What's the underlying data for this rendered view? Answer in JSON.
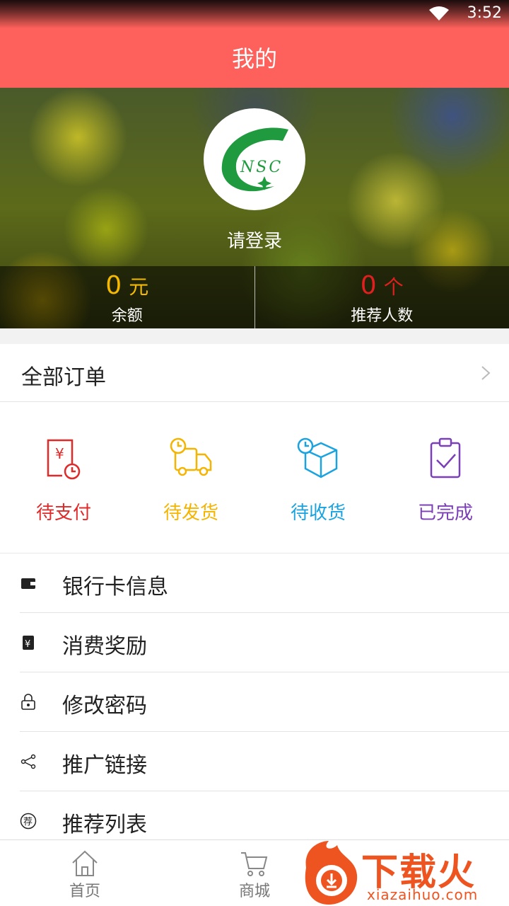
{
  "status_bar": {
    "time": "3:52"
  },
  "header": {
    "title": "我的"
  },
  "profile": {
    "logo_text": "NSC",
    "login_prompt": "请登录",
    "balance": {
      "value": "0",
      "unit": "元",
      "label": "余额",
      "color": "#f5b900"
    },
    "referrals": {
      "value": "0",
      "unit": "个",
      "label": "推荐人数",
      "color": "#e02020"
    }
  },
  "orders": {
    "title": "全部订单",
    "statuses": [
      {
        "label": "待支付",
        "icon": "pending-payment-icon",
        "color": "#e02a2a"
      },
      {
        "label": "待发货",
        "icon": "pending-shipment-icon",
        "color": "#f5b400"
      },
      {
        "label": "待收货",
        "icon": "pending-receipt-icon",
        "color": "#1aa3e0"
      },
      {
        "label": "已完成",
        "icon": "completed-icon",
        "color": "#7b3fb8"
      }
    ]
  },
  "menu": [
    {
      "label": "银行卡信息",
      "icon": "wallet-icon"
    },
    {
      "label": "消费奖励",
      "icon": "reward-icon"
    },
    {
      "label": "修改密码",
      "icon": "lock-icon"
    },
    {
      "label": "推广链接",
      "icon": "share-icon"
    },
    {
      "label": "推荐列表",
      "icon": "recommend-icon"
    }
  ],
  "tabbar": [
    {
      "label": "首页",
      "icon": "home-icon"
    },
    {
      "label": "商城",
      "icon": "cart-icon"
    }
  ],
  "watermark": {
    "text": "下载火",
    "url": "xiazaihuo.com"
  },
  "colors": {
    "brand": "#fe615c"
  }
}
